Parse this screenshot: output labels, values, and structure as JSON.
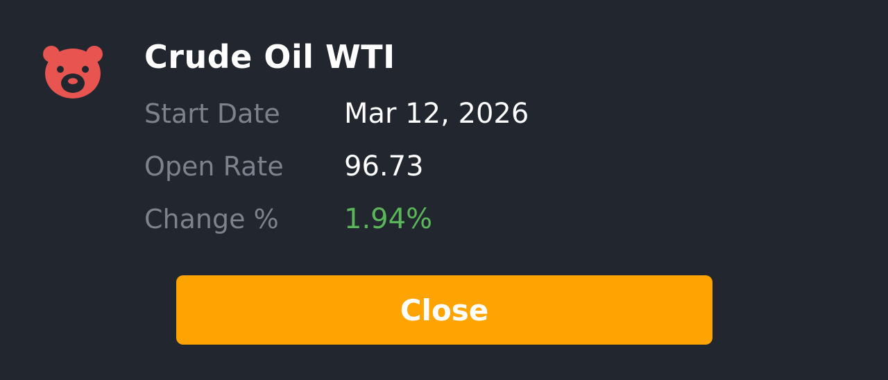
{
  "instrument": {
    "name": "Crude Oil WTI",
    "icon": "bear-icon",
    "icon_color": "#e85551"
  },
  "details": {
    "start_date": {
      "label": "Start Date",
      "value": "Mar 12, 2026"
    },
    "open_rate": {
      "label": "Open Rate",
      "value": "96.73"
    },
    "change": {
      "label": "Change %",
      "value": "1.94%",
      "color": "#5bb65a"
    }
  },
  "actions": {
    "close_label": "Close",
    "close_color": "#fea402"
  },
  "theme": {
    "background": "#22262e",
    "label_color": "#7d828b",
    "value_color": "#ffffff"
  }
}
